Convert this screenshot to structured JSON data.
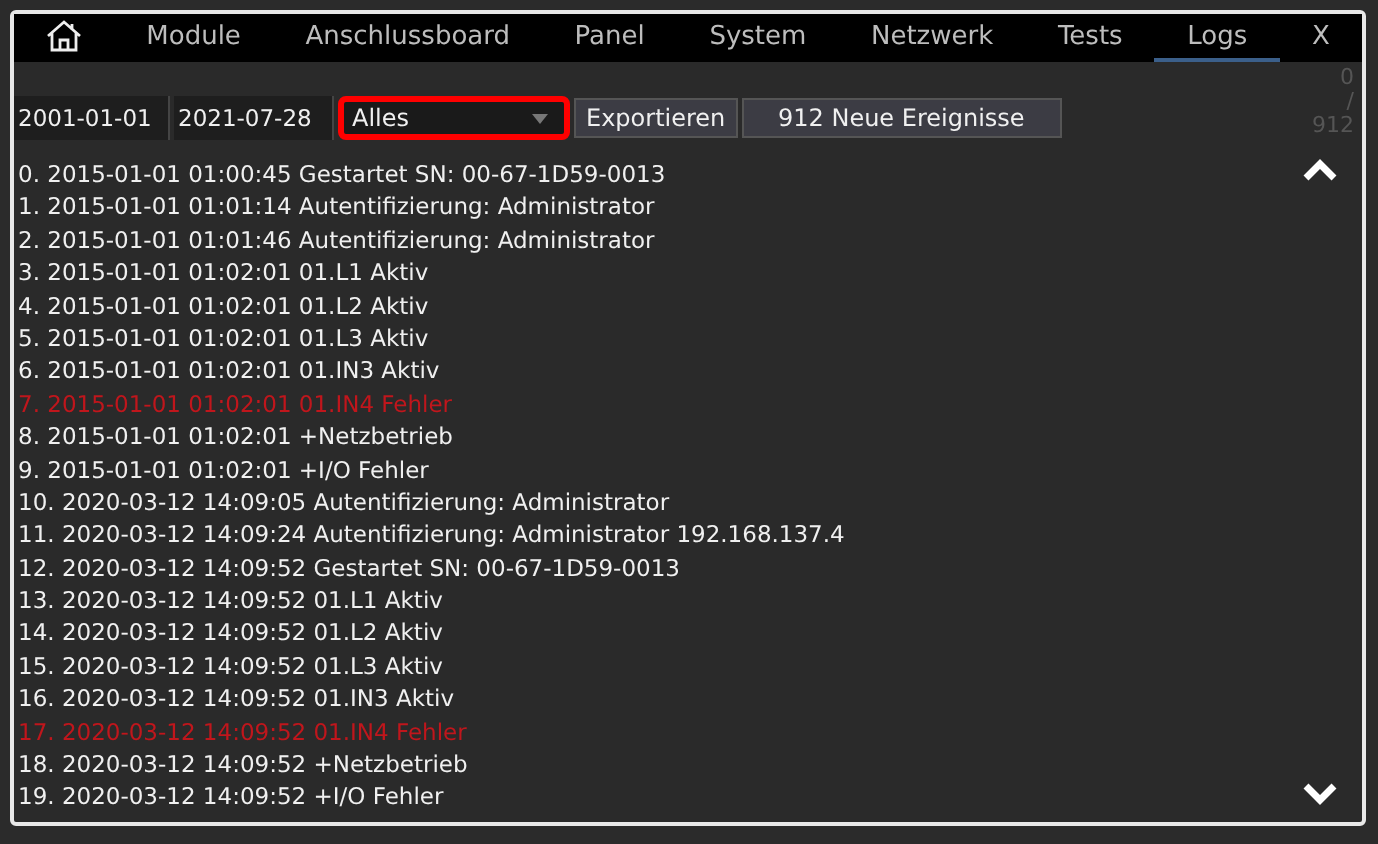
{
  "tabs": [
    {
      "kind": "home",
      "selected": false
    },
    {
      "label": "Module",
      "selected": false
    },
    {
      "label": "Anschlussboard",
      "selected": false
    },
    {
      "label": "Panel",
      "selected": false
    },
    {
      "label": "System",
      "selected": false
    },
    {
      "label": "Netzwerk",
      "selected": false
    },
    {
      "label": "Tests",
      "selected": false
    },
    {
      "label": "Logs",
      "selected": true
    },
    {
      "label": "X",
      "selected": false
    }
  ],
  "toolbar": {
    "date_from": "2001-01-01",
    "date_to": "2021-07-28",
    "filter": {
      "value": "Alles",
      "highlighted": true
    },
    "buttons": [
      "Exportieren",
      "912 Neue Ereignisse"
    ]
  },
  "counter": [
    "0",
    "/",
    "912"
  ],
  "log": [
    {
      "text": "0. 2015-01-01 01:00:45 Gestartet SN: 00-67-1D59-0013",
      "kind": "info"
    },
    {
      "text": "1. 2015-01-01 01:01:14 Autentifizierung: Administrator",
      "kind": "info"
    },
    {
      "text": "2. 2015-01-01 01:01:46 Autentifizierung: Administrator",
      "kind": "info"
    },
    {
      "text": "3. 2015-01-01 01:02:01 01.L1 Aktiv",
      "kind": "info"
    },
    {
      "text": "4. 2015-01-01 01:02:01 01.L2 Aktiv",
      "kind": "info"
    },
    {
      "text": "5. 2015-01-01 01:02:01 01.L3 Aktiv",
      "kind": "info"
    },
    {
      "text": "6. 2015-01-01 01:02:01 01.IN3 Aktiv",
      "kind": "info"
    },
    {
      "text": "7. 2015-01-01 01:02:01 01.IN4 Fehler",
      "kind": "error"
    },
    {
      "text": "8. 2015-01-01 01:02:01 +Netzbetrieb",
      "kind": "info"
    },
    {
      "text": "9. 2015-01-01 01:02:01 +I/O Fehler",
      "kind": "info"
    },
    {
      "text": "10. 2020-03-12 14:09:05 Autentifizierung: Administrator",
      "kind": "info"
    },
    {
      "text": "11. 2020-03-12 14:09:24 Autentifizierung: Administrator 192.168.137.4",
      "kind": "info"
    },
    {
      "text": "12. 2020-03-12 14:09:52 Gestartet SN: 00-67-1D59-0013",
      "kind": "info"
    },
    {
      "text": "13. 2020-03-12 14:09:52 01.L1 Aktiv",
      "kind": "info"
    },
    {
      "text": "14. 2020-03-12 14:09:52 01.L2 Aktiv",
      "kind": "info"
    },
    {
      "text": "15. 2020-03-12 14:09:52 01.L3 Aktiv",
      "kind": "info"
    },
    {
      "text": "16. 2020-03-12 14:09:52 01.IN3 Aktiv",
      "kind": "info"
    },
    {
      "text": "17. 2020-03-12 14:09:52 01.IN4 Fehler",
      "kind": "error"
    },
    {
      "text": "18. 2020-03-12 14:09:52 +Netzbetrieb",
      "kind": "info"
    },
    {
      "text": "19. 2020-03-12 14:09:52 +I/O Fehler",
      "kind": "info"
    }
  ]
}
